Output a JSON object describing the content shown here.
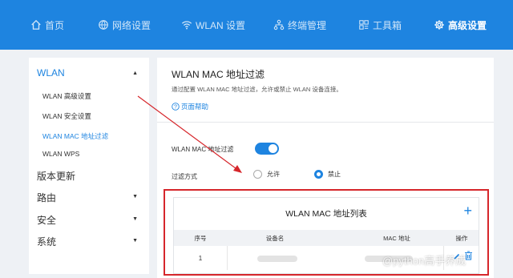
{
  "nav": {
    "items": [
      {
        "label": "首页",
        "icon": "home-icon"
      },
      {
        "label": "网络设置",
        "icon": "globe-icon"
      },
      {
        "label": "WLAN 设置",
        "icon": "wifi-icon"
      },
      {
        "label": "终端管理",
        "icon": "devices-icon"
      },
      {
        "label": "工具箱",
        "icon": "toolbox-icon"
      },
      {
        "label": "高级设置",
        "icon": "gear-icon"
      }
    ],
    "active": "高级设置"
  },
  "sidebar": {
    "wlan": "WLAN",
    "sub": [
      "WLAN 高级设置",
      "WLAN 安全设置",
      "WLAN MAC 地址过滤",
      "WLAN WPS"
    ],
    "sections": [
      "版本更新",
      "路由",
      "安全",
      "系统"
    ]
  },
  "main": {
    "title": "WLAN MAC 地址过滤",
    "desc": "通过配置 WLAN MAC 地址过滤，允许或禁止 WLAN 设备连接。",
    "help": "页面帮助",
    "toggle_label": "WLAN MAC 地址过滤",
    "toggle_on": true,
    "filter_label": "过滤方式",
    "option_allow": "允许",
    "option_deny": "禁止",
    "selected": "禁止"
  },
  "list": {
    "title": "WLAN MAC 地址列表",
    "columns": [
      "序号",
      "设备名",
      "MAC 地址",
      "操作"
    ],
    "rows": [
      {
        "index": "1"
      }
    ]
  },
  "colors": {
    "accent": "#1e84e0",
    "highlight": "#d6262b"
  },
  "watermark": "@python高手养成"
}
